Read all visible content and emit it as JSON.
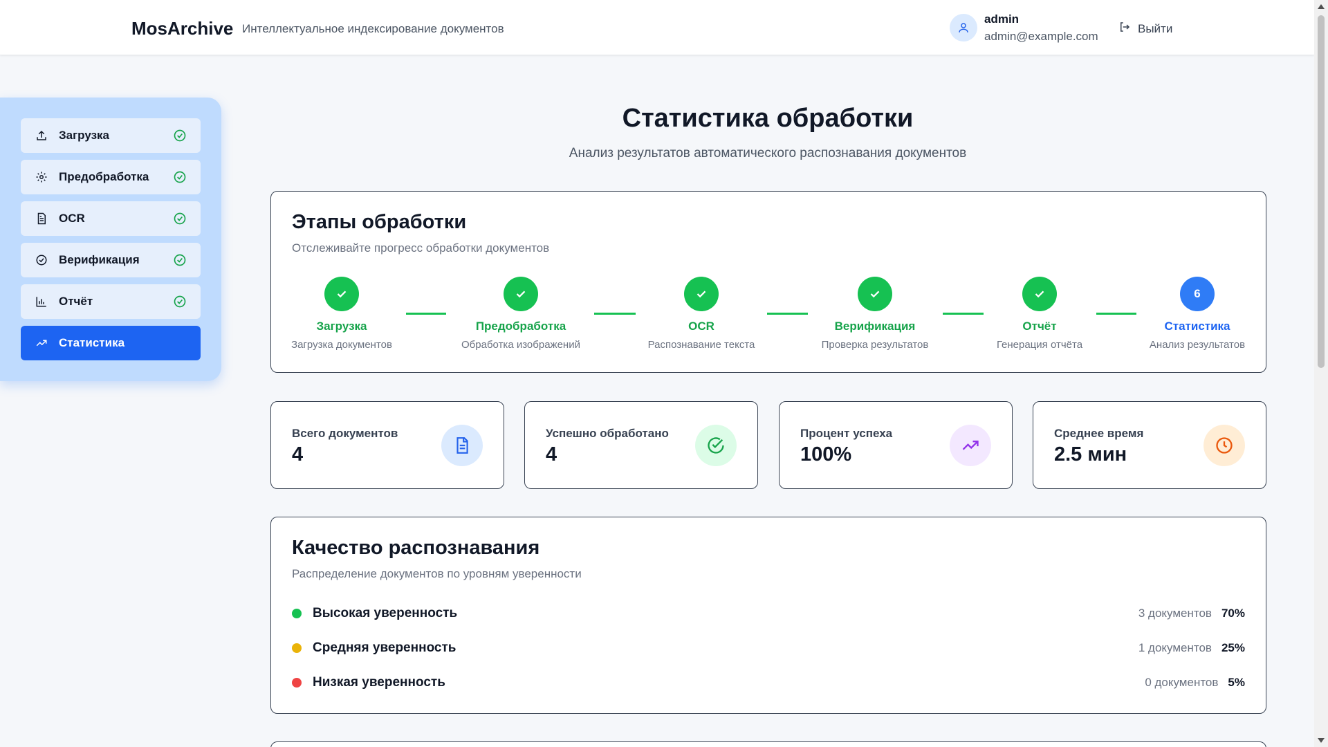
{
  "header": {
    "brand": "MosArchive",
    "tagline": "Интеллектуальное индексирование документов",
    "user_name": "admin",
    "user_email": "admin@example.com",
    "logout_label": "Выйти"
  },
  "sidebar": {
    "items": [
      {
        "label": "Загрузка",
        "icon": "upload-icon",
        "done": true
      },
      {
        "label": "Предобработка",
        "icon": "gear-icon",
        "done": true
      },
      {
        "label": "OCR",
        "icon": "document-icon",
        "done": true
      },
      {
        "label": "Верификация",
        "icon": "check-circle-icon",
        "done": true
      },
      {
        "label": "Отчёт",
        "icon": "bar-chart-icon",
        "done": true
      },
      {
        "label": "Статистика",
        "icon": "trending-up-icon",
        "active": true
      }
    ]
  },
  "page": {
    "title": "Статистика обработки",
    "subtitle": "Анализ результатов автоматического распознавания документов"
  },
  "stages_card": {
    "title": "Этапы обработки",
    "subtitle": "Отслеживайте прогресс обработки документов",
    "stages": [
      {
        "label": "Загрузка",
        "desc": "Загрузка документов",
        "status": "done"
      },
      {
        "label": "Предобработка",
        "desc": "Обработка изображений",
        "status": "done"
      },
      {
        "label": "OCR",
        "desc": "Распознавание текста",
        "status": "done"
      },
      {
        "label": "Верификация",
        "desc": "Проверка результатов",
        "status": "done"
      },
      {
        "label": "Отчёт",
        "desc": "Генерация отчёта",
        "status": "done"
      },
      {
        "label": "Статистика",
        "desc": "Анализ результатов",
        "status": "current",
        "number": "6"
      }
    ]
  },
  "stats": [
    {
      "label": "Всего документов",
      "value": "4",
      "icon": "document-icon",
      "icon_bg": "#dbeafe",
      "icon_color": "#2563eb"
    },
    {
      "label": "Успешно обработано",
      "value": "4",
      "icon": "check-circle-icon",
      "icon_bg": "#dcfce7",
      "icon_color": "#16a34a"
    },
    {
      "label": "Процент успеха",
      "value": "100%",
      "icon": "trending-up-icon",
      "icon_bg": "#f3e8ff",
      "icon_color": "#9333ea"
    },
    {
      "label": "Среднее время",
      "value": "2.5 мин",
      "icon": "clock-icon",
      "icon_bg": "#ffedd5",
      "icon_color": "#ea580c"
    }
  ],
  "quality_card": {
    "title": "Качество распознавания",
    "subtitle": "Распределение документов по уровням уверенности",
    "rows": [
      {
        "label": "Высокая уверенность",
        "count": "3 документов",
        "pct": "70%",
        "color": "#16c152"
      },
      {
        "label": "Средняя уверенность",
        "count": "1 документов",
        "pct": "25%",
        "color": "#eab308"
      },
      {
        "label": "Низкая уверенность",
        "count": "0 документов",
        "pct": "5%",
        "color": "#ef4444"
      }
    ]
  },
  "colors": {
    "accent": "#1d64f2",
    "success": "#16c152",
    "sidebar_bg": "#bfdbfe"
  }
}
